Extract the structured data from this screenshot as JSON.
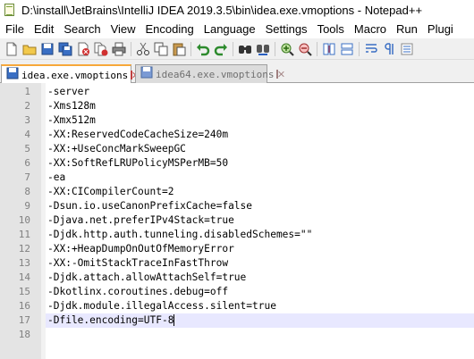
{
  "window": {
    "title": "D:\\install\\JetBrains\\IntelliJ IDEA 2019.3.5\\bin\\idea.exe.vmoptions - Notepad++"
  },
  "menu": [
    "File",
    "Edit",
    "Search",
    "View",
    "Encoding",
    "Language",
    "Settings",
    "Tools",
    "Macro",
    "Run",
    "Plugi"
  ],
  "toolbar": {
    "icons": [
      "new-file-icon",
      "open-file-icon",
      "save-icon",
      "save-all-icon",
      "close-icon",
      "close-all-icon",
      "print-icon",
      "cut-icon",
      "copy-icon",
      "paste-icon",
      "undo-icon",
      "redo-icon",
      "find-icon",
      "replace-icon",
      "zoom-in-icon",
      "zoom-out-icon",
      "sync-vertical-icon",
      "sync-horizontal-icon",
      "word-wrap-icon",
      "show-all-chars-icon"
    ]
  },
  "tabs": [
    {
      "label": "idea.exe.vmoptions",
      "active": true
    },
    {
      "label": "idea64.exe.vmoptions",
      "active": false
    }
  ],
  "editor": {
    "current_line": 17,
    "lines": [
      {
        "n": "1",
        "text": "-server"
      },
      {
        "n": "2",
        "text": "-Xms128m"
      },
      {
        "n": "3",
        "text": "-Xmx512m"
      },
      {
        "n": "4",
        "text": "-XX:ReservedCodeCacheSize=240m"
      },
      {
        "n": "5",
        "text": "-XX:+UseConcMarkSweepGC"
      },
      {
        "n": "6",
        "text": "-XX:SoftRefLRUPolicyMSPerMB=50"
      },
      {
        "n": "7",
        "text": "-ea"
      },
      {
        "n": "8",
        "text": "-XX:CICompilerCount=2"
      },
      {
        "n": "9",
        "text": "-Dsun.io.useCanonPrefixCache=false"
      },
      {
        "n": "10",
        "text": "-Djava.net.preferIPv4Stack=true"
      },
      {
        "n": "11",
        "text": "-Djdk.http.auth.tunneling.disabledSchemes=\"\""
      },
      {
        "n": "12",
        "text": "-XX:+HeapDumpOnOutOfMemoryError"
      },
      {
        "n": "13",
        "text": "-XX:-OmitStackTraceInFastThrow"
      },
      {
        "n": "14",
        "text": "-Djdk.attach.allowAttachSelf=true"
      },
      {
        "n": "15",
        "text": "-Dkotlinx.coroutines.debug=off"
      },
      {
        "n": "16",
        "text": "-Djdk.module.illegalAccess.silent=true"
      },
      {
        "n": "17",
        "text": "-Dfile.encoding=UTF-8"
      },
      {
        "n": "18",
        "text": ""
      }
    ]
  },
  "colors": {
    "active_tab_accent": "#f7a83a",
    "current_line_bg": "#e8e8ff",
    "gutter_bg": "#e4e4e4"
  }
}
